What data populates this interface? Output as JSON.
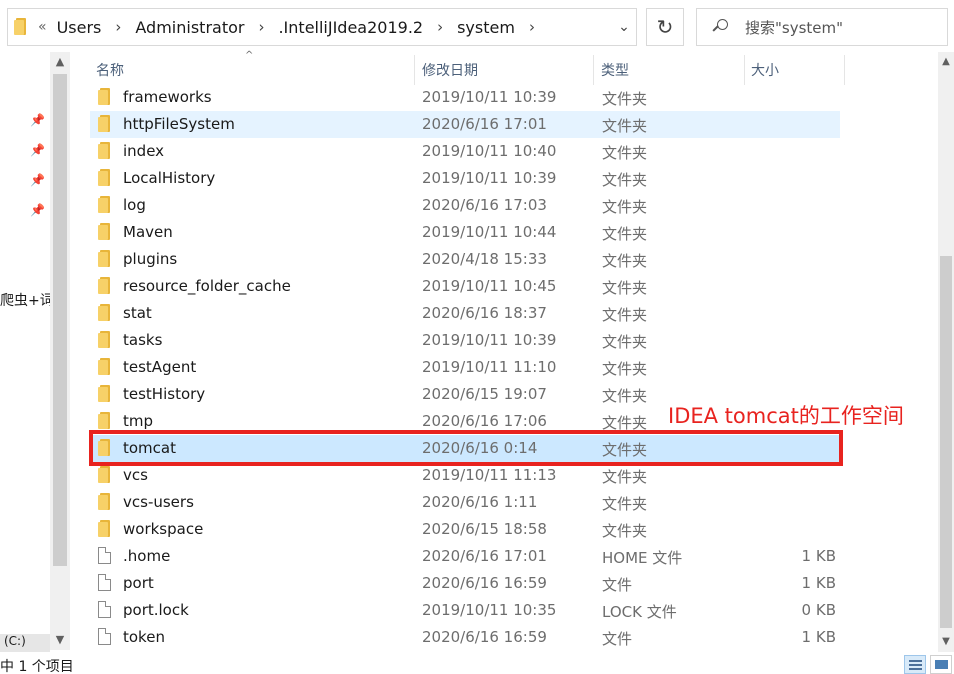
{
  "address_bar": {
    "overflow": "«",
    "crumbs": [
      "Users",
      "Administrator",
      ".IntelliJIdea2019.2",
      "system"
    ]
  },
  "search": {
    "placeholder": "搜索\"system\""
  },
  "nav": {
    "partial_text": "爬虫+词",
    "drive_label": "(C:)"
  },
  "columns": {
    "name": "名称",
    "date": "修改日期",
    "type": "类型",
    "size": "大小"
  },
  "files": [
    {
      "name": "frameworks",
      "date": "2019/10/11 10:39",
      "type": "文件夹",
      "size": "",
      "kind": "folder",
      "state": ""
    },
    {
      "name": "httpFileSystem",
      "date": "2020/6/16 17:01",
      "type": "文件夹",
      "size": "",
      "kind": "folder",
      "state": "hover"
    },
    {
      "name": "index",
      "date": "2019/10/11 10:40",
      "type": "文件夹",
      "size": "",
      "kind": "folder",
      "state": ""
    },
    {
      "name": "LocalHistory",
      "date": "2019/10/11 10:39",
      "type": "文件夹",
      "size": "",
      "kind": "folder",
      "state": ""
    },
    {
      "name": "log",
      "date": "2020/6/16 17:03",
      "type": "文件夹",
      "size": "",
      "kind": "folder",
      "state": ""
    },
    {
      "name": "Maven",
      "date": "2019/10/11 10:44",
      "type": "文件夹",
      "size": "",
      "kind": "folder",
      "state": ""
    },
    {
      "name": "plugins",
      "date": "2020/4/18 15:33",
      "type": "文件夹",
      "size": "",
      "kind": "folder",
      "state": ""
    },
    {
      "name": "resource_folder_cache",
      "date": "2019/10/11 10:45",
      "type": "文件夹",
      "size": "",
      "kind": "folder",
      "state": ""
    },
    {
      "name": "stat",
      "date": "2020/6/16 18:37",
      "type": "文件夹",
      "size": "",
      "kind": "folder",
      "state": ""
    },
    {
      "name": "tasks",
      "date": "2019/10/11 10:39",
      "type": "文件夹",
      "size": "",
      "kind": "folder",
      "state": ""
    },
    {
      "name": "testAgent",
      "date": "2019/10/11 11:10",
      "type": "文件夹",
      "size": "",
      "kind": "folder",
      "state": ""
    },
    {
      "name": "testHistory",
      "date": "2020/6/15 19:07",
      "type": "文件夹",
      "size": "",
      "kind": "folder",
      "state": ""
    },
    {
      "name": "tmp",
      "date": "2020/6/16 17:06",
      "type": "文件夹",
      "size": "",
      "kind": "folder",
      "state": ""
    },
    {
      "name": "tomcat",
      "date": "2020/6/16 0:14",
      "type": "文件夹",
      "size": "",
      "kind": "folder",
      "state": "selected"
    },
    {
      "name": "vcs",
      "date": "2019/10/11 11:13",
      "type": "文件夹",
      "size": "",
      "kind": "folder",
      "state": ""
    },
    {
      "name": "vcs-users",
      "date": "2020/6/16 1:11",
      "type": "文件夹",
      "size": "",
      "kind": "folder",
      "state": ""
    },
    {
      "name": "workspace",
      "date": "2020/6/15 18:58",
      "type": "文件夹",
      "size": "",
      "kind": "folder",
      "state": ""
    },
    {
      "name": ".home",
      "date": "2020/6/16 17:01",
      "type": "HOME 文件",
      "size": "1 KB",
      "kind": "file",
      "state": ""
    },
    {
      "name": "port",
      "date": "2020/6/16 16:59",
      "type": "文件",
      "size": "1 KB",
      "kind": "file",
      "state": ""
    },
    {
      "name": "port.lock",
      "date": "2019/10/11 10:35",
      "type": "LOCK 文件",
      "size": "0 KB",
      "kind": "file",
      "state": ""
    },
    {
      "name": "token",
      "date": "2020/6/16 16:59",
      "type": "文件",
      "size": "1 KB",
      "kind": "file",
      "state": ""
    }
  ],
  "annotation": {
    "text": "IDEA tomcat的工作空间",
    "color": "#e8231f"
  },
  "status": {
    "text": "中 1 个项目"
  },
  "colors": {
    "hover": "#e5f3ff",
    "selected": "#cce8ff",
    "header_text": "#4c607a",
    "folder": "#f7d168"
  }
}
